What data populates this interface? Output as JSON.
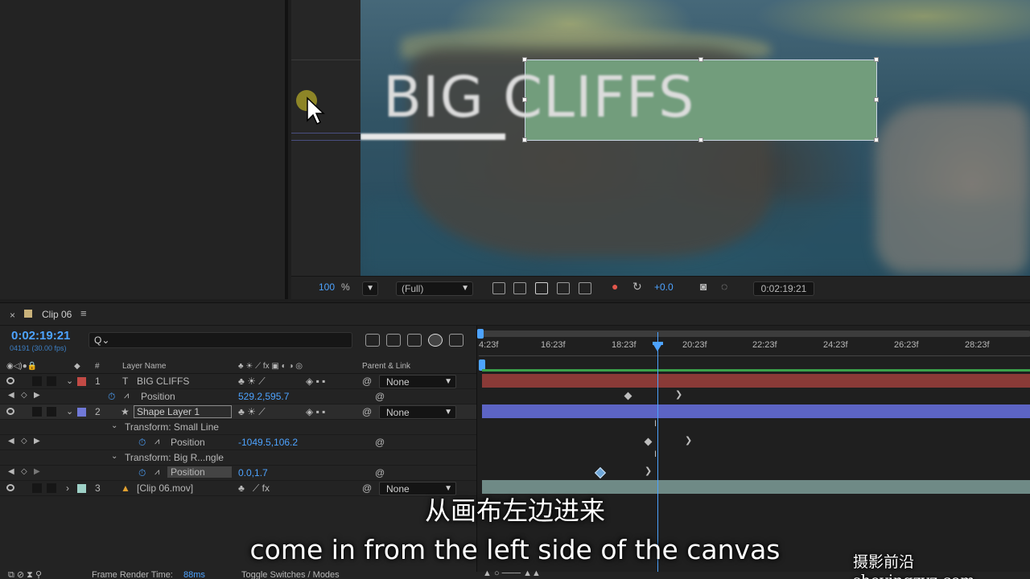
{
  "viewer": {
    "title_text": "BIG CLIFFS",
    "zoom_value": "100",
    "zoom_unit": "%",
    "resolution": "(Full)",
    "exposure": "+0.0",
    "timecode": "0:02:19:21"
  },
  "timeline": {
    "tab_close": "×",
    "tab_label": "Clip 06",
    "tab_menu": "≡",
    "current_time": "0:02:19:21",
    "current_frames": "04191 (30.00 fps)",
    "search_icon": "Q⌄",
    "columns": {
      "number": "#",
      "layer_name": "Layer Name",
      "parent_link": "Parent & Link"
    },
    "ruler_labels": [
      "4:23f",
      "16:23f",
      "18:23f",
      "20:23f",
      "22:23f",
      "24:23f",
      "26:23f",
      "28:23f"
    ],
    "rows": [
      {
        "type": "layer",
        "num": "1",
        "type_glyph": "T",
        "name": "BIG CLIFFS",
        "parent": "None",
        "label_color": "#c24a45"
      },
      {
        "type": "prop",
        "name": "Position",
        "value": "529.2,595.7"
      },
      {
        "type": "layer",
        "num": "2",
        "type_glyph": "★",
        "name": "Shape Layer 1",
        "parent": "None",
        "label_color": "#7079d8"
      },
      {
        "type": "group",
        "name": "Transform: Small Line"
      },
      {
        "type": "prop",
        "name": "Position",
        "value": "-1049.5,106.2"
      },
      {
        "type": "group",
        "name": "Transform: Big R...ngle"
      },
      {
        "type": "prop",
        "name": "Position",
        "value": "0.0,1.7"
      },
      {
        "type": "layer",
        "num": "3",
        "type_glyph": "▲",
        "name": "[Clip 06.mov]",
        "parent": "None",
        "label_color": "#9ed1c7"
      }
    ],
    "chevron_open": "⌄",
    "chevron_closed": "›"
  },
  "status": {
    "frame_render_label": "Frame Render Time:",
    "frame_render_value": "88ms",
    "toggle_label": "Toggle Switches / Modes"
  },
  "subtitles": {
    "chinese": "从画布左边进来",
    "english": "come in from the left side of the canvas"
  },
  "watermark": "摄影前沿 sheyingzyz.com",
  "colors": {
    "accent": "#4da3ff",
    "layer1_bar": "#8a3a37",
    "layer2_bar": "#5c64c4",
    "layer3_bar": "#6f8a86",
    "green_rect": "#6e9e7a"
  }
}
